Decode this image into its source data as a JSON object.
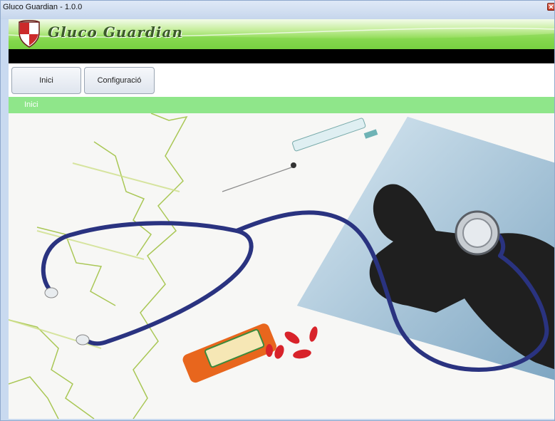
{
  "window": {
    "title": "Gluco Guardian - 1.0.0"
  },
  "banner": {
    "app_name": "Gluco Guardian"
  },
  "tabs": [
    {
      "label": "Inici"
    },
    {
      "label": "Configuració"
    }
  ],
  "section": {
    "title": "Inici"
  },
  "colors": {
    "banner_green": "#8fdc55",
    "section_green": "#8fe68a",
    "stethoscope_blue": "#2a3380",
    "pill_red": "#d8232a"
  },
  "icons": {
    "logo": "shield-logo-icon",
    "close": "close-icon"
  }
}
